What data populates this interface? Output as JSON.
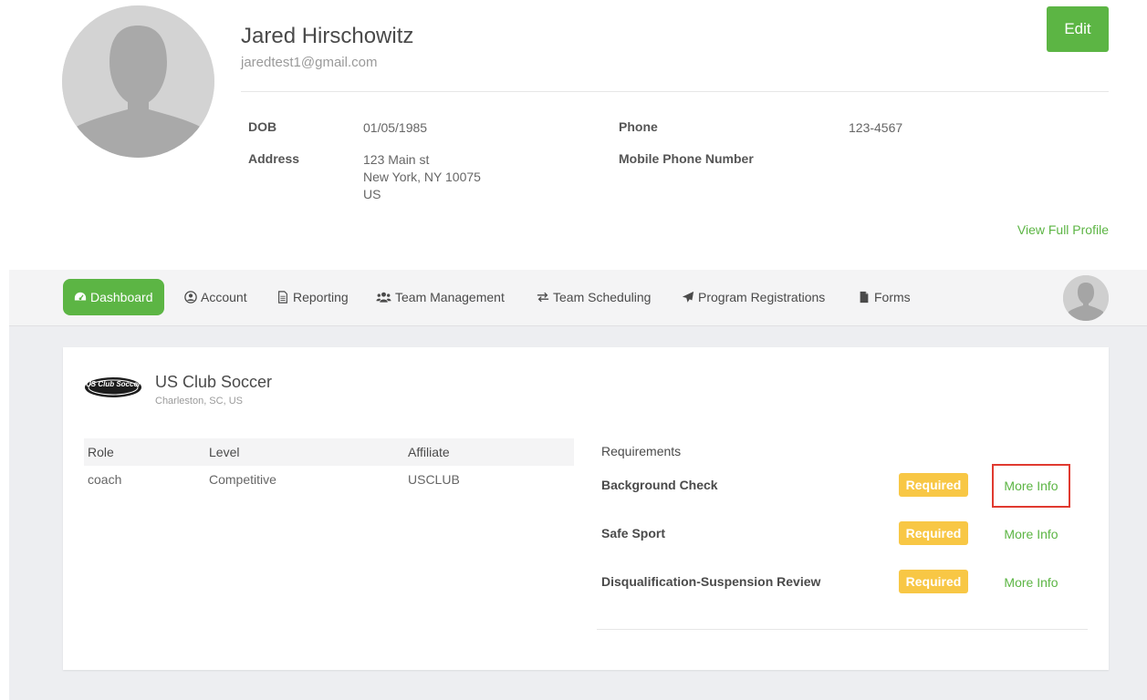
{
  "profile": {
    "name": "Jared Hirschowitz",
    "email": "jaredtest1@gmail.com",
    "edit_label": "Edit",
    "dob_label": "DOB",
    "dob_value": "01/05/1985",
    "address_label": "Address",
    "address_line1": "123 Main st",
    "address_line2": "New York, NY 10075",
    "address_line3": "US",
    "phone_label": "Phone",
    "phone_value": "123-4567",
    "mobile_label": "Mobile Phone Number",
    "view_full_profile": "View Full Profile"
  },
  "nav": {
    "items": [
      {
        "label": "Dashboard",
        "icon": "dashboard-icon",
        "active": true
      },
      {
        "label": "Account",
        "icon": "user-circle-icon"
      },
      {
        "label": "Reporting",
        "icon": "document-icon"
      },
      {
        "label": "Team Management",
        "icon": "users-icon"
      },
      {
        "label": "Team Scheduling",
        "icon": "exchange-arrows-icon"
      },
      {
        "label": "Program Registrations",
        "icon": "paper-plane-icon"
      },
      {
        "label": "Forms",
        "icon": "file-icon"
      }
    ]
  },
  "org": {
    "name": "US Club Soccer",
    "location": "Charleston, SC, US",
    "logo_text": "US Club Soccer"
  },
  "roles": {
    "headers": [
      "Role",
      "Level",
      "Affiliate"
    ],
    "rows": [
      [
        "coach",
        "Competitive",
        "USCLUB"
      ]
    ]
  },
  "requirements": {
    "title": "Requirements",
    "items": [
      {
        "name": "Background Check",
        "status": "Required",
        "link": "More Info"
      },
      {
        "name": "Safe Sport",
        "status": "Required",
        "link": "More Info"
      },
      {
        "name": "Disqualification-Suspension Review",
        "status": "Required",
        "link": "More Info"
      }
    ]
  },
  "colors": {
    "accent_green": "#5cb544",
    "badge_yellow": "#f8c745",
    "highlight_red": "#e03a30",
    "page_gray": "#edeef1"
  }
}
